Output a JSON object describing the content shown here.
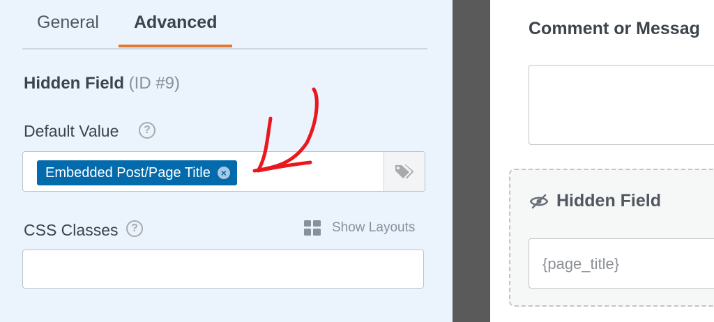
{
  "tabs": [
    {
      "label": "General",
      "active": false
    },
    {
      "label": "Advanced",
      "active": true
    }
  ],
  "field": {
    "name": "Hidden Field",
    "id_text": "(ID #9)"
  },
  "default_value": {
    "label": "Default Value",
    "smart_tag": "Embedded Post/Page Title",
    "chip_close_glyph": "×",
    "tag_icon": "tags-icon"
  },
  "css_classes": {
    "label": "CSS Classes",
    "value": "",
    "show_layouts_label": "Show Layouts"
  },
  "help_glyph": "?",
  "preview": {
    "comment_label": "Comment or Messag",
    "hidden_field_label": "Hidden Field",
    "hidden_field_value": "{page_title}",
    "hidden_icon": "eye-slash-icon"
  },
  "colors": {
    "accent_orange": "#e27730",
    "chip_blue": "#036aab",
    "annotation_red": "#e8181e"
  }
}
